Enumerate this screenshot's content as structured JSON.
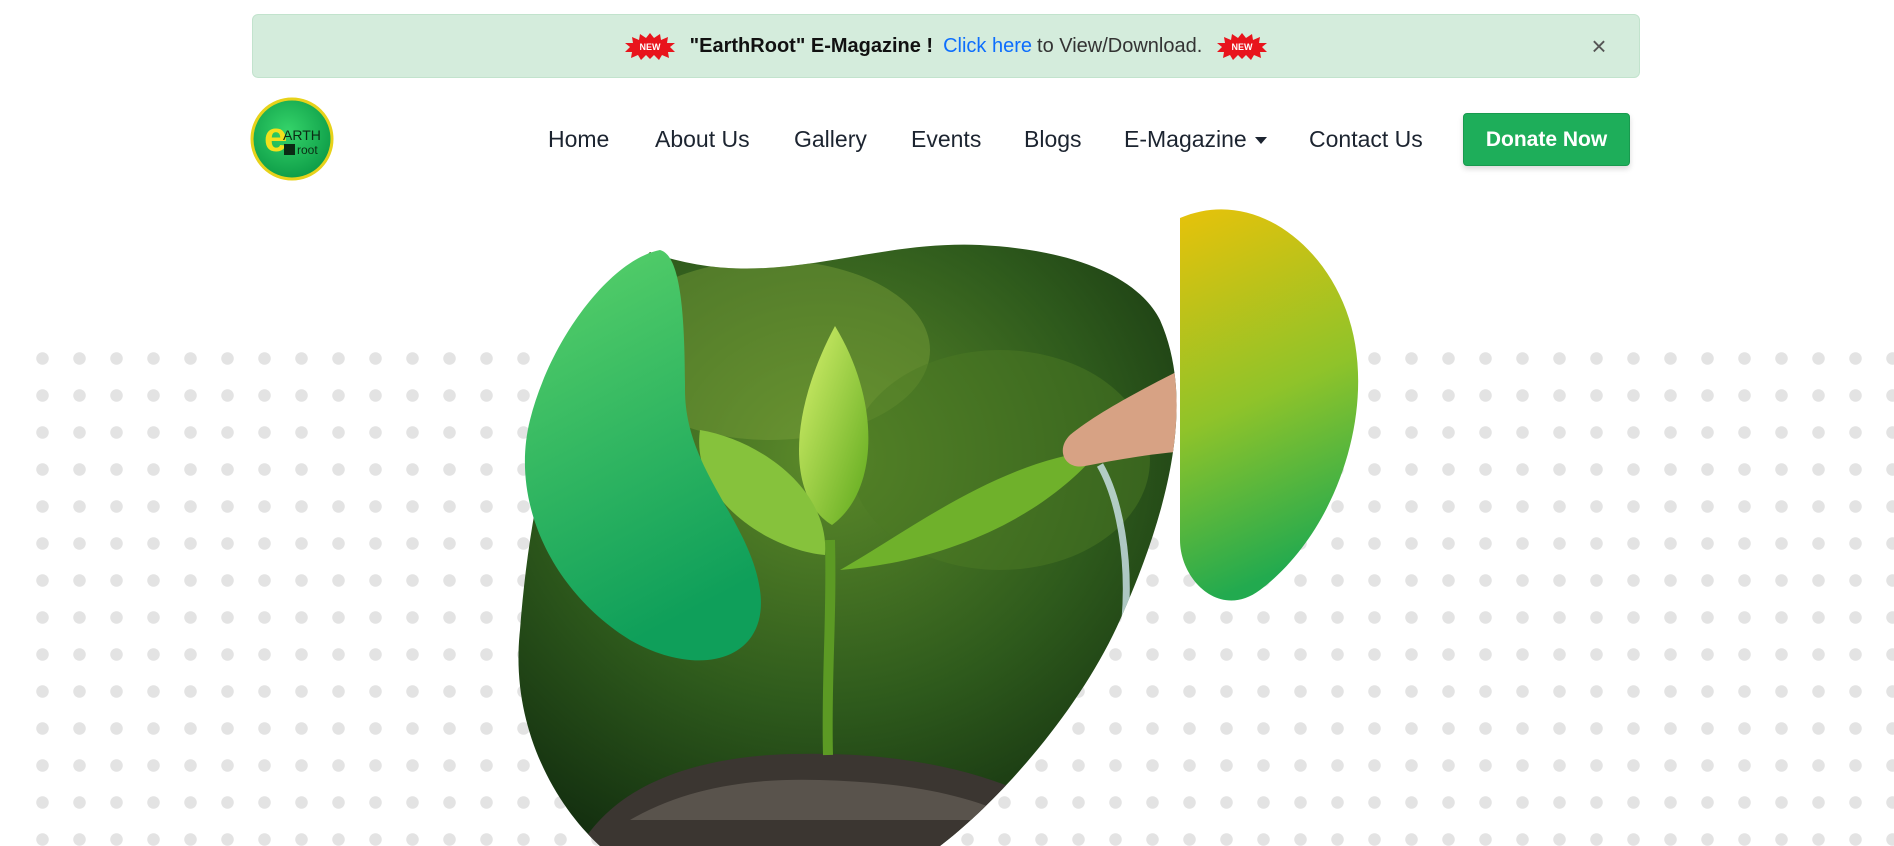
{
  "alert": {
    "badge_text": "NEW",
    "title": "\"EarthRoot\" E-Magazine !",
    "link_text": "Click here",
    "rest_text": "to View/Download.",
    "close_icon": "×"
  },
  "logo": {
    "alt": "EarthRoot logo",
    "letter": "e",
    "line1": "ARTH",
    "line2": "root"
  },
  "nav": {
    "items": [
      {
        "label": "Home"
      },
      {
        "label": "About Us"
      },
      {
        "label": "Gallery"
      },
      {
        "label": "Events"
      },
      {
        "label": "Blogs"
      },
      {
        "label": "E-Magazine"
      },
      {
        "label": "Contact Us"
      }
    ],
    "donate_label": "Donate Now"
  },
  "colors": {
    "brand_green": "#1eae5a",
    "alert_bg": "#d4ecdc",
    "link_blue": "#0d6efd",
    "accent_yellow": "#e6c300"
  },
  "hero": {
    "image_alt": "Seedling sprouting from soil being watered by a hand"
  }
}
